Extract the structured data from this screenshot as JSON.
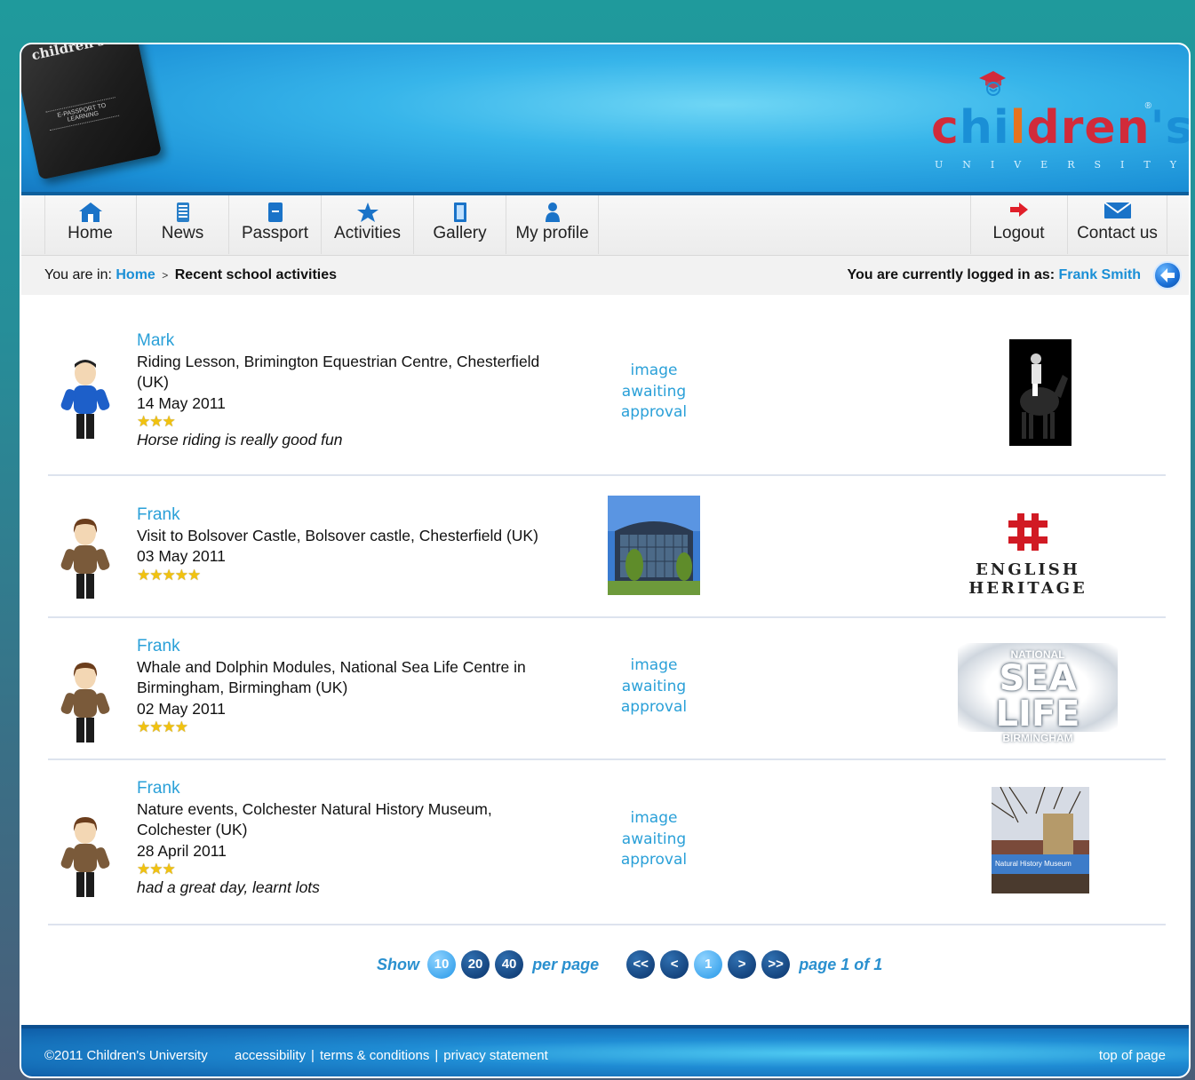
{
  "header": {
    "passport_title": "children's",
    "passport_sub": "E-PASSPORT TO LEARNING",
    "brand_word": [
      "c",
      "hi",
      "l",
      "dren",
      "'s"
    ],
    "brand_sub": "UNIVERSITY",
    "brand_reg": "®"
  },
  "nav": {
    "items": [
      {
        "label": "Home",
        "icon": "home-icon"
      },
      {
        "label": "News",
        "icon": "news-icon"
      },
      {
        "label": "Passport",
        "icon": "passport-icon"
      },
      {
        "label": "Activities",
        "icon": "star-icon"
      },
      {
        "label": "Gallery",
        "icon": "gallery-icon"
      },
      {
        "label": "My profile",
        "icon": "profile-icon"
      }
    ],
    "right_items": [
      {
        "label": "Logout",
        "icon": "logout-arrow-icon"
      },
      {
        "label": "Contact us",
        "icon": "envelope-icon"
      }
    ]
  },
  "breadcrumb": {
    "prefix": "You are in:",
    "home": "Home",
    "separator": ">",
    "current": "Recent school activities"
  },
  "login": {
    "prefix": "You are currently logged in as:",
    "user": "Frank Smith"
  },
  "activities": [
    {
      "name": "Mark",
      "title": "Riding Lesson, Brimington Equestrian Centre, Chesterfield (UK)",
      "date": "14 May 2011",
      "stars": "★★★",
      "rating": 3,
      "comment": "Horse riding is really good fun",
      "image_status": "image awaiting approval",
      "thumb": "horse-rider-photo"
    },
    {
      "name": "Frank",
      "title": "Visit to Bolsover Castle, Bolsover castle, Chesterfield (UK)",
      "date": "03 May 2011",
      "stars": "★★★★★",
      "rating": 5,
      "comment": "",
      "image_status": "",
      "thumb": "english-heritage-logo",
      "logo_text": "ENGLISH HERITAGE"
    },
    {
      "name": "Frank",
      "title": "Whale and Dolphin Modules, National Sea Life Centre in Birmingham, Birmingham (UK)",
      "date": "02 May 2011",
      "stars": "★★★★",
      "rating": 4,
      "comment": "",
      "image_status": "image awaiting approval",
      "thumb": "sea-life-logo",
      "logo_top": "NATIONAL",
      "logo_main": "SEA LIFE",
      "logo_bottom": "BIRMINGHAM"
    },
    {
      "name": "Frank",
      "title": "Nature events, Colchester Natural History Museum, Colchester (UK)",
      "date": "28 April 2011",
      "stars": "★★★",
      "rating": 3,
      "comment": "had a great day, learnt lots",
      "image_status": "image awaiting approval",
      "thumb": "museum-photo",
      "photo_caption": "Natural History Museum"
    }
  ],
  "pager": {
    "show": "Show",
    "per_page_options": [
      "10",
      "20",
      "40"
    ],
    "per_page": "per page",
    "first": "<<",
    "prev": "<",
    "current": "1",
    "next": ">",
    "last": ">>",
    "page_info": "page 1 of 1"
  },
  "footer": {
    "copyright": "©2011 Children's University",
    "links": [
      "accessibility",
      "terms & conditions",
      "privacy statement"
    ],
    "top": "top of page"
  },
  "colors": {
    "accent": "#1a8fd6",
    "link": "#2aa0d8",
    "star": "#f1c20f",
    "nav_bg": "#f2f2f2"
  }
}
